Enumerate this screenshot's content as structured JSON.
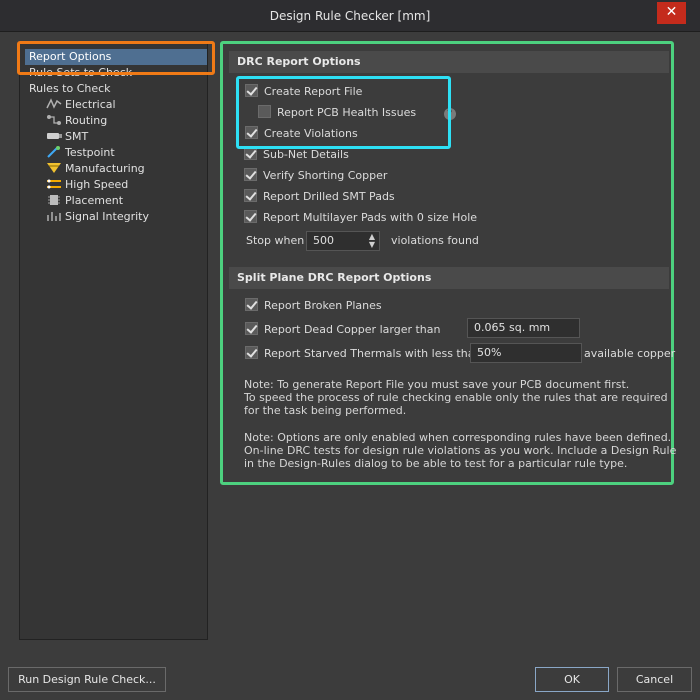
{
  "window": {
    "title": "Design Rule Checker [mm]",
    "close_glyph": "✕"
  },
  "tree": {
    "items": [
      {
        "label": "Report Options"
      },
      {
        "label": "Rule Sets to Check"
      },
      {
        "label": "Rules to Check"
      },
      {
        "label": "Electrical",
        "icon": "electrical-icon"
      },
      {
        "label": "Routing",
        "icon": "routing-icon"
      },
      {
        "label": "SMT",
        "icon": "smt-icon"
      },
      {
        "label": "Testpoint",
        "icon": "testpoint-icon"
      },
      {
        "label": "Manufacturing",
        "icon": "manufacturing-icon"
      },
      {
        "label": "High Speed",
        "icon": "high-speed-icon"
      },
      {
        "label": "Placement",
        "icon": "placement-icon"
      },
      {
        "label": "Signal Integrity",
        "icon": "signal-integrity-icon"
      }
    ]
  },
  "drc": {
    "header": "DRC Report Options",
    "options": [
      {
        "label": "Create Report File",
        "checked": true
      },
      {
        "label": "Report PCB Health Issues",
        "checked": false
      },
      {
        "label": "Create Violations",
        "checked": true
      },
      {
        "label": "Sub-Net Details",
        "checked": true
      },
      {
        "label": "Verify Shorting Copper",
        "checked": true
      },
      {
        "label": "Report Drilled SMT Pads",
        "checked": true
      },
      {
        "label": "Report Multilayer Pads with 0 size Hole",
        "checked": true
      }
    ],
    "stop_when_label": "Stop when",
    "stop_when_value": "500",
    "violations_found_label": "violations found",
    "help_glyph": "?"
  },
  "split_plane": {
    "header": "Split Plane DRC Report Options",
    "broken_planes": {
      "label": "Report Broken Planes",
      "checked": true
    },
    "dead_copper": {
      "label": "Report Dead Copper larger than",
      "checked": true,
      "value": "0.065 sq. mm"
    },
    "starved_thermals": {
      "label": "Report Starved Thermals with less than",
      "checked": true,
      "value": "50%",
      "suffix": "available copper"
    }
  },
  "notes": {
    "note1": [
      "Note: To generate Report File you must save your PCB document first.",
      "To speed the process of rule checking enable only the rules that are required",
      "for the task being performed."
    ],
    "note2": [
      "Note: Options are only enabled when corresponding rules have been defined.",
      "On-line DRC tests for design rule violations as you work. Include a Design Rule",
      "in the Design-Rules dialog to be able to test for a particular rule  type."
    ]
  },
  "buttons": {
    "run": "Run Design Rule Check...",
    "ok": "OK",
    "cancel": "Cancel"
  },
  "colors": {
    "highlight_orange": "#f07a16",
    "highlight_cyan": "#2ee0f5",
    "highlight_green": "#4dd17f",
    "selection": "#4f6f91",
    "close_red": "#c42b1c"
  }
}
